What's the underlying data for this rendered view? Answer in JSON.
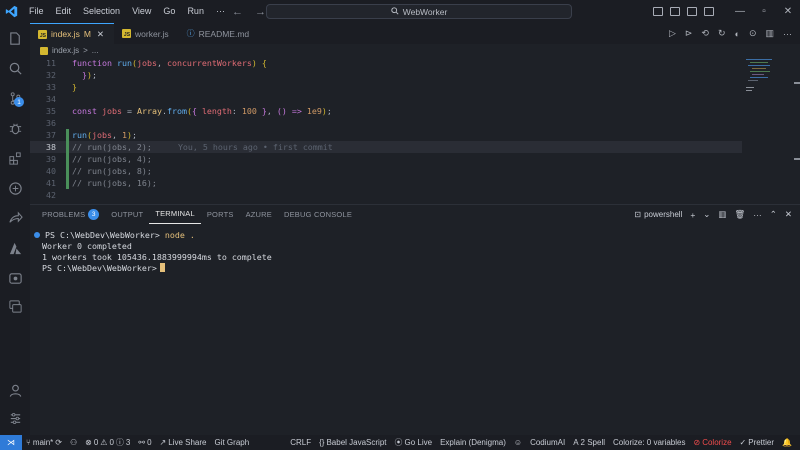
{
  "titlebar": {
    "menu": [
      "File",
      "Edit",
      "Selection",
      "View",
      "Go",
      "Run",
      "···"
    ],
    "search": "WebWorker"
  },
  "tabs": [
    {
      "label": "index.js",
      "modified": "M",
      "active": true
    },
    {
      "label": "worker.js",
      "active": false
    },
    {
      "label": "README.md",
      "active": false
    }
  ],
  "breadcrumb": {
    "file": "index.js",
    "sep": ">",
    "more": "..."
  },
  "editor": {
    "lines": [
      {
        "num": "11",
        "text": "function run(jobs, concurrentWorkers) {"
      },
      {
        "num": "32",
        "text": "  });"
      },
      {
        "num": "33",
        "text": "}"
      },
      {
        "num": "34",
        "text": ""
      },
      {
        "num": "35",
        "text": "const jobs = Array.from({ length: 100 }, () => 1e9);"
      },
      {
        "num": "36",
        "text": ""
      },
      {
        "num": "37",
        "text": "run(jobs, 1);"
      },
      {
        "num": "38",
        "text": "// run(jobs, 2);"
      },
      {
        "num": "39",
        "text": "// run(jobs, 4);"
      },
      {
        "num": "40",
        "text": "// run(jobs, 8);"
      },
      {
        "num": "41",
        "text": "// run(jobs, 16);"
      },
      {
        "num": "42",
        "text": ""
      }
    ],
    "blame": "You, 5 hours ago • first commit"
  },
  "panel": {
    "tabs": [
      "PROBLEMS",
      "OUTPUT",
      "TERMINAL",
      "PORTS",
      "AZURE",
      "DEBUG CONSOLE"
    ],
    "problems_count": "3",
    "active_tab": "TERMINAL",
    "shell": "powershell"
  },
  "terminal": {
    "prompt1": "PS C:\\WebDev\\WebWorker>",
    "command": "node .",
    "out1": "Worker 0 completed",
    "out2": "1 workers took 105436.1883999994ms to complete",
    "prompt2": "PS C:\\WebDev\\WebWorker>"
  },
  "status": {
    "branch": "main*",
    "errors": "0",
    "warnings": "0",
    "info": "3",
    "ports": "0",
    "live_share": "Live Share",
    "git_graph": "Git Graph",
    "eol": "CRLF",
    "language": "Babel JavaScript",
    "go_live": "Go Live",
    "explain": "Explain (Denigma)",
    "codium": "CodiumAI",
    "spell": "2 Spell",
    "colorize_vars": "Colorize: 0 variables",
    "colorize": "Colorize",
    "prettier": "Prettier"
  },
  "colors": {
    "accent": "#3b8eea",
    "background": "#1e2127",
    "statusbar": "#1b1d23"
  }
}
